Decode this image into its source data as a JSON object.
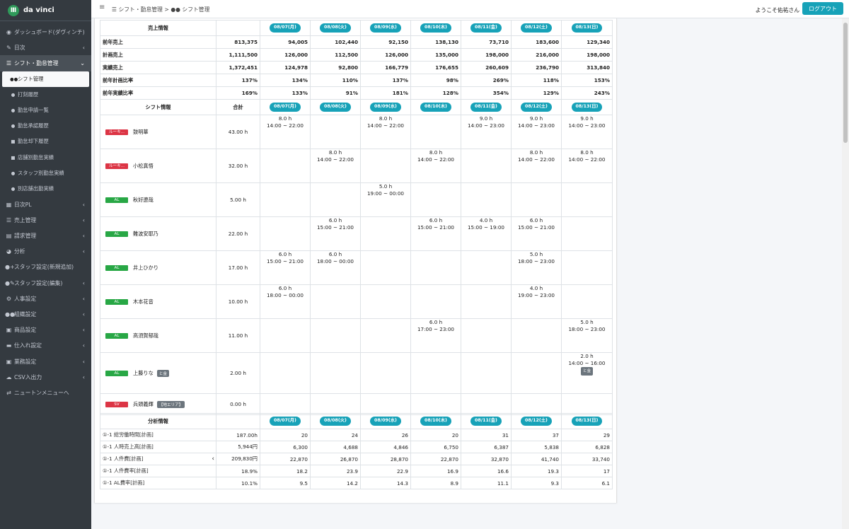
{
  "app": {
    "logo_text": "da vinci",
    "logo_mark": "Ⅲ"
  },
  "sidebar": {
    "items": [
      {
        "label": "ダッシュボード(ダヴィンチ)",
        "icon": "dashboard-icon",
        "glyph": "◉",
        "type": "main",
        "arrow": ""
      },
      {
        "label": "日次",
        "icon": "edit-icon",
        "glyph": "✎",
        "type": "main",
        "arrow": "‹"
      },
      {
        "label": "シフト・勤怠管理",
        "icon": "list-icon",
        "glyph": "☰",
        "type": "open",
        "arrow": "⌄"
      },
      {
        "label": "シフト管理",
        "icon": "users-icon",
        "glyph": "●●",
        "type": "active",
        "arrow": ""
      },
      {
        "label": "打刻履歴",
        "icon": "user-clock-icon",
        "glyph": "●",
        "type": "sub",
        "arrow": ""
      },
      {
        "label": "勤怠申請一覧",
        "icon": "user-icon",
        "glyph": "●",
        "type": "sub",
        "arrow": ""
      },
      {
        "label": "勤怠承認履歴",
        "icon": "user-check-icon",
        "glyph": "●",
        "type": "sub",
        "arrow": ""
      },
      {
        "label": "勤怠却下履歴",
        "icon": "window-close-icon",
        "glyph": "■",
        "type": "sub",
        "arrow": ""
      },
      {
        "label": "店舗別勤怠実績",
        "icon": "store-icon",
        "glyph": "■",
        "type": "sub",
        "arrow": ""
      },
      {
        "label": "スタッフ別勤怠実績",
        "icon": "user-tie-icon",
        "glyph": "●",
        "type": "sub",
        "arrow": ""
      },
      {
        "label": "別店舗出勤実績",
        "icon": "user-friends-icon",
        "glyph": "●",
        "type": "sub",
        "arrow": ""
      },
      {
        "label": "日次PL",
        "icon": "table-icon",
        "glyph": "▦",
        "type": "main",
        "arrow": "‹"
      },
      {
        "label": "売上管理",
        "icon": "list-icon",
        "glyph": "☰",
        "type": "main",
        "arrow": "‹"
      },
      {
        "label": "請求管理",
        "icon": "calendar-icon",
        "glyph": "▤",
        "type": "main",
        "arrow": "‹"
      },
      {
        "label": "分析",
        "icon": "chart-pie-icon",
        "glyph": "◕",
        "type": "main",
        "arrow": "‹"
      },
      {
        "label": "スタッフ設定(新規追加)",
        "icon": "user-plus-icon",
        "glyph": "●+",
        "type": "main",
        "arrow": ""
      },
      {
        "label": "スタッフ設定(編集)",
        "icon": "user-edit-icon",
        "glyph": "●✎",
        "type": "main",
        "arrow": "‹"
      },
      {
        "label": "人事設定",
        "icon": "cog-icon",
        "glyph": "⚙",
        "type": "main",
        "arrow": "‹"
      },
      {
        "label": "組織設定",
        "icon": "users-cog-icon",
        "glyph": "●●",
        "type": "main",
        "arrow": "‹"
      },
      {
        "label": "商品設定",
        "icon": "box-icon",
        "glyph": "▣",
        "type": "main",
        "arrow": "‹"
      },
      {
        "label": "仕入れ設定",
        "icon": "truck-icon",
        "glyph": "▬",
        "type": "main",
        "arrow": "‹"
      },
      {
        "label": "業務設定",
        "icon": "briefcase-icon",
        "glyph": "▣",
        "type": "main",
        "arrow": "‹"
      },
      {
        "label": "CSV入出力",
        "icon": "cloud-icon",
        "glyph": "☁",
        "type": "main",
        "arrow": "‹"
      },
      {
        "label": "ニュートンメニューへ",
        "icon": "exchange-icon",
        "glyph": "⇄",
        "type": "main",
        "arrow": ""
      }
    ]
  },
  "topbar": {
    "menu_glyph": "≡",
    "breadcrumb": "☰ シフト・勤怠管理 >  ●● シフト管理",
    "welcome": "ようこそ佑祐さん",
    "logout": "ログアウト"
  },
  "dates": [
    "08/07(月)",
    "08/08(火)",
    "08/09(水)",
    "08/10(木)",
    "08/11(金)",
    "08/12(土)",
    "08/13(日)"
  ],
  "sales": {
    "header": "売上情報",
    "rows": [
      {
        "label": "前年売上",
        "total": "813,375",
        "values": [
          "94,005",
          "102,440",
          "92,150",
          "138,130",
          "73,710",
          "183,600",
          "129,340"
        ]
      },
      {
        "label": "計画売上",
        "total": "1,111,500",
        "values": [
          "126,000",
          "112,500",
          "126,000",
          "135,000",
          "198,000",
          "216,000",
          "198,000"
        ]
      },
      {
        "label": "実績売上",
        "total": "1,372,451",
        "values": [
          "124,978",
          "92,800",
          "166,779",
          "176,655",
          "260,609",
          "236,790",
          "313,840"
        ]
      },
      {
        "label": "前年計画比率",
        "total": "137%",
        "values": [
          "134%",
          "110%",
          "137%",
          "98%",
          "269%",
          "118%",
          "153%"
        ]
      },
      {
        "label": "前年実績比率",
        "total": "169%",
        "values": [
          "133%",
          "91%",
          "181%",
          "128%",
          "354%",
          "129%",
          "243%"
        ]
      }
    ]
  },
  "shift": {
    "header": "シフト情報",
    "total_header": "合計",
    "staff": [
      {
        "badge": "ルーキ...",
        "badge_color": "#dc3545",
        "name": "鼓明華",
        "tag": "",
        "total": "43.00 h",
        "days": [
          {
            "h": "8.0 h",
            "t": "14:00 ~ 22:00"
          },
          null,
          {
            "h": "8.0 h",
            "t": "14:00 ~ 22:00"
          },
          null,
          {
            "h": "9.0 h",
            "t": "14:00 ~ 23:00"
          },
          {
            "h": "9.0 h",
            "t": "14:00 ~ 23:00"
          },
          {
            "h": "9.0 h",
            "t": "14:00 ~ 23:00"
          }
        ]
      },
      {
        "badge": "ルーキ...",
        "badge_color": "#dc3545",
        "name": "小松真悟",
        "tag": "",
        "total": "32.00 h",
        "days": [
          null,
          {
            "h": "8.0 h",
            "t": "14:00 ~ 22:00"
          },
          null,
          {
            "h": "8.0 h",
            "t": "14:00 ~ 22:00"
          },
          null,
          {
            "h": "8.0 h",
            "t": "14:00 ~ 22:00"
          },
          {
            "h": "8.0 h",
            "t": "14:00 ~ 22:00"
          }
        ]
      },
      {
        "badge": "AL",
        "badge_color": "#28a745",
        "name": "秋好遼哉",
        "tag": "",
        "total": "5.00 h",
        "days": [
          null,
          null,
          {
            "h": "5.0 h",
            "t": "19:00 ~ 00:00"
          },
          null,
          null,
          null,
          null
        ]
      },
      {
        "badge": "AL",
        "badge_color": "#28a745",
        "name": "難波安耶乃",
        "tag": "",
        "total": "22.00 h",
        "days": [
          null,
          {
            "h": "6.0 h",
            "t": "15:00 ~ 21:00"
          },
          null,
          {
            "h": "6.0 h",
            "t": "15:00 ~ 21:00"
          },
          {
            "h": "4.0 h",
            "t": "15:00 ~ 19:00"
          },
          {
            "h": "6.0 h",
            "t": "15:00 ~ 21:00"
          },
          null
        ]
      },
      {
        "badge": "AL",
        "badge_color": "#28a745",
        "name": "井上ひかり",
        "tag": "",
        "total": "17.00 h",
        "days": [
          {
            "h": "6.0 h",
            "t": "15:00 ~ 21:00"
          },
          {
            "h": "6.0 h",
            "t": "18:00 ~ 00:00"
          },
          null,
          null,
          null,
          {
            "h": "5.0 h",
            "t": "18:00 ~ 23:00"
          },
          null
        ]
      },
      {
        "badge": "AL",
        "badge_color": "#28a745",
        "name": "木本花音",
        "tag": "",
        "total": "10.00 h",
        "days": [
          {
            "h": "6.0 h",
            "t": "18:00 ~ 00:00"
          },
          null,
          null,
          null,
          null,
          {
            "h": "4.0 h",
            "t": "19:00 ~ 23:00"
          },
          null
        ]
      },
      {
        "badge": "AL",
        "badge_color": "#28a745",
        "name": "高須賀郁哉",
        "tag": "",
        "total": "11.00 h",
        "days": [
          null,
          null,
          null,
          {
            "h": "6.0 h",
            "t": "17:00 ~ 23:00"
          },
          null,
          null,
          {
            "h": "5.0 h",
            "t": "18:00 ~ 23:00"
          }
        ]
      },
      {
        "badge": "AL",
        "badge_color": "#28a745",
        "name": "上藤りな",
        "tag": "と金",
        "total": "2.00 h",
        "days": [
          null,
          null,
          null,
          null,
          null,
          null,
          {
            "h": "2.0 h",
            "t": "14:00 ~ 16:00",
            "tag": "と金"
          }
        ]
      },
      {
        "badge": "SV",
        "badge_color": "#dc3545",
        "name": "兵頭義輝",
        "tag": "【地エリア】",
        "total": "0.00 h",
        "days": [
          null,
          null,
          null,
          null,
          null,
          null,
          null
        ]
      }
    ]
  },
  "analysis": {
    "header": "分析情報",
    "rows": [
      {
        "label": "①-1 総労働時間[計画]",
        "total": "187.00h",
        "values": [
          "20",
          "24",
          "26",
          "20",
          "31",
          "37",
          "29"
        ]
      },
      {
        "label": "①-1 人時売上高[計画]",
        "total": "5,944円",
        "values": [
          "6,300",
          "4,688",
          "4,846",
          "6,750",
          "6,387",
          "5,838",
          "6,828"
        ]
      },
      {
        "label": "①-1 人件費[計画]",
        "total": "209,830円",
        "values": [
          "22,870",
          "26,870",
          "28,870",
          "22,870",
          "32,870",
          "41,740",
          "33,740"
        ]
      },
      {
        "label": "①-1 人件費率[計画]",
        "total": "18.9%",
        "values": [
          "18.2",
          "23.9",
          "22.9",
          "16.9",
          "16.6",
          "19.3",
          "17"
        ]
      },
      {
        "label": "①-1 AL費率[計画]",
        "total": "10.1%",
        "values": [
          "9.5",
          "14.2",
          "14.3",
          "8.9",
          "11.1",
          "9.3",
          "6.1"
        ]
      }
    ],
    "chevron": "‹"
  }
}
